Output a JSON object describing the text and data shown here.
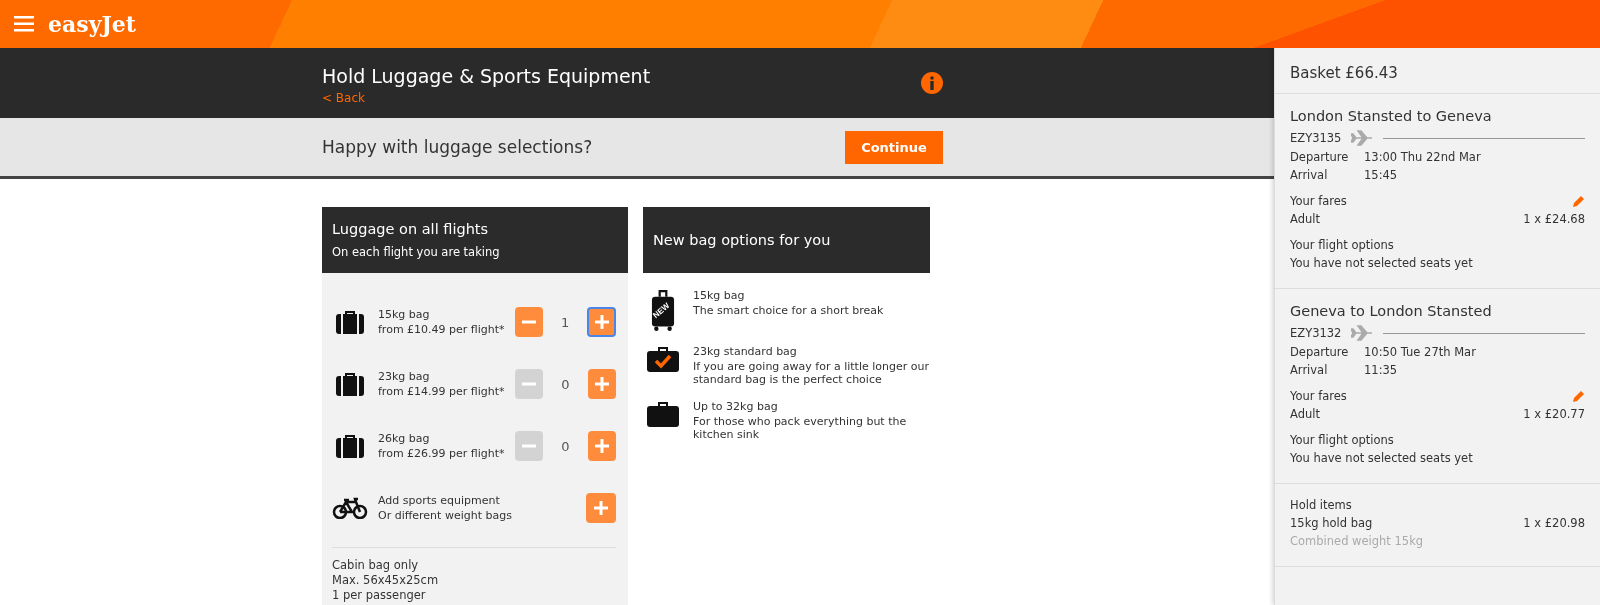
{
  "header": {
    "logo": "easyJet"
  },
  "page_bar": {
    "title": "Hold Luggage & Sports Equipment",
    "back_link": "< Back"
  },
  "confirm_bar": {
    "question": "Happy with luggage selections?",
    "button": "Continue"
  },
  "luggage_card": {
    "title": "Luggage on all flights",
    "subtitle": "On each flight you are taking",
    "items": [
      {
        "kind": "bag",
        "name": "15kg bag",
        "price": "from £10.49 per flight*",
        "count": "1",
        "minus_disabled": false,
        "plus_focused": true
      },
      {
        "kind": "bag",
        "name": "23kg bag",
        "price": "from £14.99 per flight*",
        "count": "0",
        "minus_disabled": true,
        "plus_focused": false
      },
      {
        "kind": "bag",
        "name": "26kg bag",
        "price": "from £26.99 per flight*",
        "count": "0",
        "minus_disabled": true,
        "plus_focused": false
      },
      {
        "kind": "sports",
        "name": "Add sports equipment",
        "price": "Or different weight bags",
        "plus_focused": false
      }
    ],
    "cabin_note": [
      "Cabin bag only",
      "Max. 56x45x25cm",
      "1 per passenger"
    ]
  },
  "options_card": {
    "title": "New bag options for you",
    "options": [
      {
        "kind": "new",
        "badge": "NEW",
        "name": "15kg bag",
        "description": "The smart choice for a short break"
      },
      {
        "kind": "standard",
        "name": "23kg standard bag",
        "description": "If you are going away for a little longer our standard bag is the perfect choice"
      },
      {
        "kind": "large",
        "name": "Up to 32kg bag",
        "description": "For those who pack everything but the kitchen sink"
      }
    ]
  },
  "basket": {
    "title": "Basket £66.43",
    "flights": [
      {
        "route": "London Stansted to Geneva",
        "flight_no": "EZY3135",
        "departure_label": "Departure",
        "departure": "13:00 Thu 22nd Mar",
        "arrival_label": "Arrival",
        "arrival": "15:45",
        "fares_label": "Your fares",
        "fare_type": "Adult",
        "fare_price": "1 x £24.68",
        "options_label": "Your flight options",
        "options_text": "You have not selected seats yet"
      },
      {
        "route": "Geneva to London Stansted",
        "flight_no": "EZY3132",
        "departure_label": "Departure",
        "departure": "10:50 Tue 27th Mar",
        "arrival_label": "Arrival",
        "arrival": "11:35",
        "fares_label": "Your fares",
        "fare_type": "Adult",
        "fare_price": "1 x £20.77",
        "options_label": "Your flight options",
        "options_text": "You have not selected seats yet"
      }
    ],
    "hold": {
      "label": "Hold items",
      "item": "15kg hold bag",
      "price": "1 x £20.98",
      "note": "Combined weight 15kg"
    }
  }
}
